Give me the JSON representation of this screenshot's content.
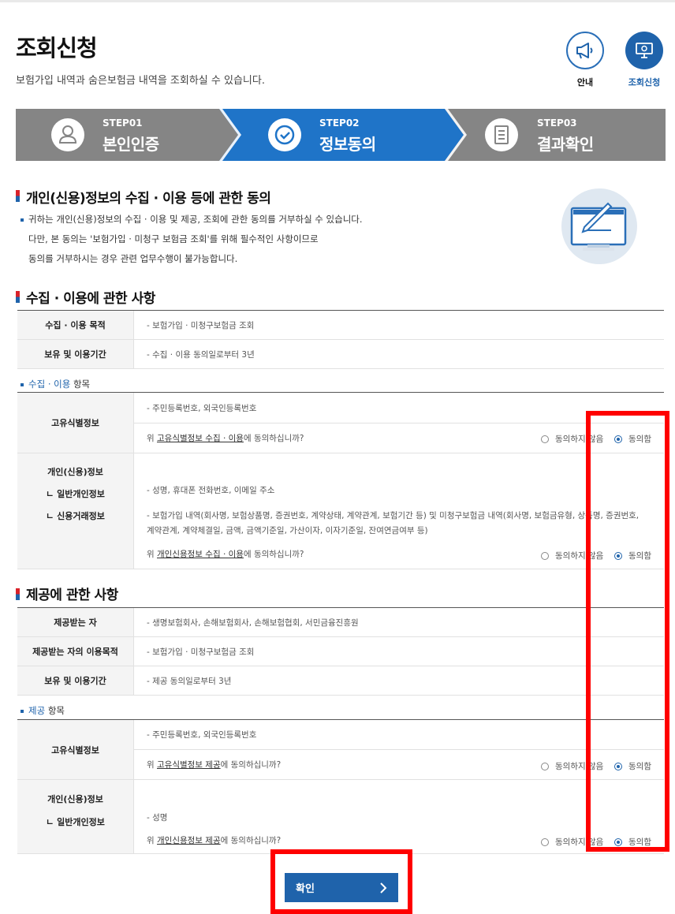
{
  "header": {
    "title": "조회신청",
    "subtitle": "보험가입 내역과 숨은보험금 내역을 조회하실 수 있습니다.",
    "guide_label": "안내",
    "inquiry_label": "조회신청"
  },
  "steps": [
    {
      "num": "STEP01",
      "name": "본인인증"
    },
    {
      "num": "STEP02",
      "name": "정보동의"
    },
    {
      "num": "STEP03",
      "name": "결과확인"
    }
  ],
  "intro": {
    "heading": "개인(신용)정보의 수집 · 이용 등에 관한 동의",
    "line1": "귀하는 개인(신용)정보의 수집 · 이용 및 제공, 조회에 관한 동의를 거부하실 수 있습니다.",
    "line2": "다만, 본 동의는 '보험가입 · 미청구 보험금 조회'를 위해 필수적인 사항이므로",
    "line3": "동의를 거부하시는 경우 관련 업무수행이 불가능합니다."
  },
  "collect": {
    "heading": "수집 · 이용에 관한 사항",
    "purpose_label": "수집 · 이용 목적",
    "purpose_value": "- 보험가입 · 미청구보험금 조회",
    "period_label": "보유 및 이용기간",
    "period_value": "- 수집 · 이용 동의일로부터 3년",
    "items_hl": "수집 · 이용",
    "items_rest": " 항목",
    "unique_label": "고유식별정보",
    "unique_value": "- 주민등록번호, 외국인등록번호",
    "unique_q_pre": "위 ",
    "unique_q_u": "고유식별정보 수집 · 이용",
    "unique_q_post": "에 동의하십니까?",
    "credit_label": "개인(신용)정보",
    "general_label": "ㄴ 일반개인정보",
    "credit_tx_label": "ㄴ 신용거래정보",
    "general_value": "- 성명, 휴대폰 전화번호, 이메일 주소",
    "credit_value1": "- 보험가입 내역(회사명, 보험상품명, 증권번호, 계약상태, 계약관계, 보험기간 등) 및 미청구보험금 내역(회사명, 보험금유형, 상품명, 증권번호,",
    "credit_value2": "계약관계, 계약체결일, 금액, 금액기준일, 가산이자, 이자기준일, 잔여연금여부 등)",
    "credit_q_pre": "위 ",
    "credit_q_u": "개인신용정보 수집 · 이용",
    "credit_q_post": "에 동의하십니까?"
  },
  "provide": {
    "heading": "제공에 관한 사항",
    "recipient_label": "제공받는 자",
    "recipient_value": "- 생명보험회사, 손해보험회사, 손해보험협회, 서민금융진흥원",
    "purpose_label": "제공받는 자의 이용목적",
    "purpose_value": "- 보험가입 · 미청구보험금 조회",
    "period_label": "보유 및 이용기간",
    "period_value": "- 제공 동의일로부터 3년",
    "items_hl": "제공",
    "items_rest": " 항목",
    "unique_label": "고유식별정보",
    "unique_value": "- 주민등록번호, 외국인등록번호",
    "unique_q_pre": "위 ",
    "unique_q_u": "고유식별정보 제공",
    "unique_q_post": "에 동의하십니까?",
    "credit_label": "개인(신용)정보",
    "general_label": "ㄴ 일반개인정보",
    "general_value": "- 성명",
    "credit_q_pre": "위 ",
    "credit_q_u": "개인신용정보 제공",
    "credit_q_post": "에 동의하십니까?"
  },
  "radio": {
    "disagree": "동의하지 않음",
    "agree": "동의함"
  },
  "confirm_label": "확인",
  "colors": {
    "primary": "#1f63ab",
    "step_gray": "#858585",
    "highlight": "#ff0000"
  }
}
